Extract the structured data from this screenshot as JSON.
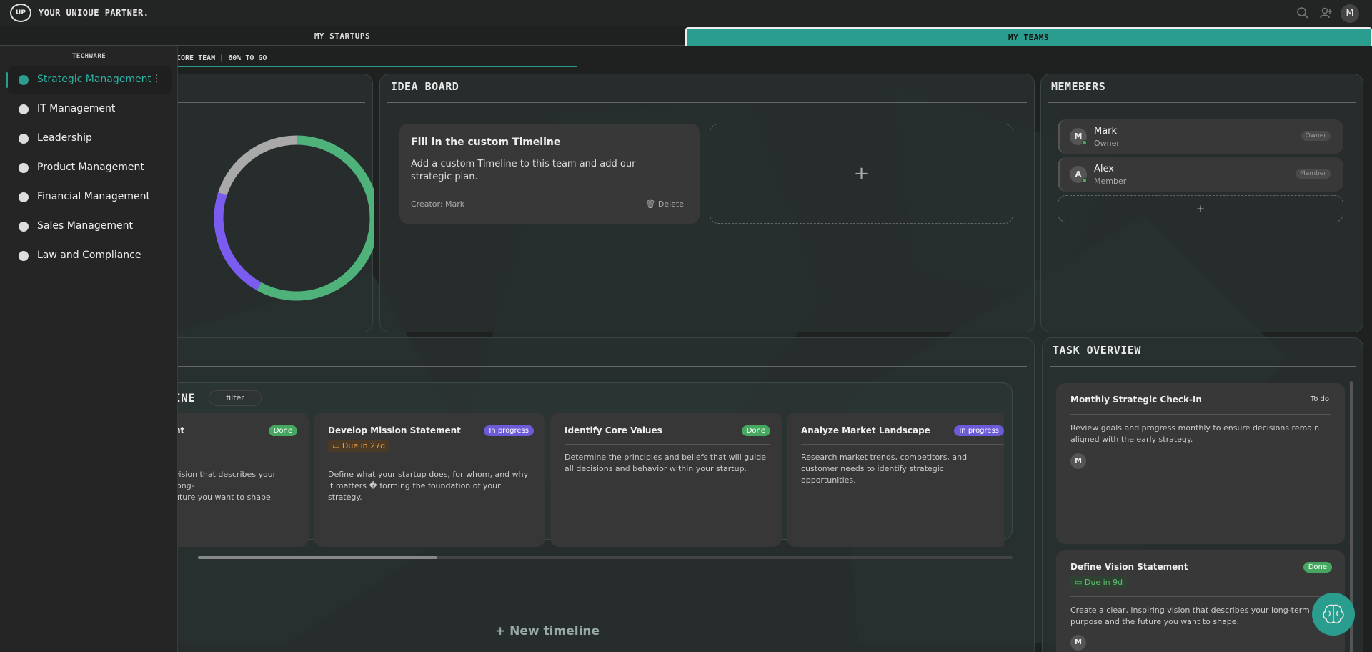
{
  "header": {
    "logo_text": "UP",
    "brand": "YOUR UNIQUE PARTNER.",
    "search_icon": "search-icon",
    "add_user_icon": "add-user-icon",
    "avatar_initial": "M"
  },
  "tabs": [
    {
      "label": "MY STARTUPS",
      "active": false
    },
    {
      "label": "MY TEAMS",
      "active": true
    }
  ],
  "team_progress": {
    "label": "CORE TEAM | 60% TO GO",
    "fraction_done": 0.4
  },
  "sidebar": {
    "heading": "TECHWARE",
    "items": [
      {
        "label": "Strategic Management",
        "active": true
      },
      {
        "label": "IT Management"
      },
      {
        "label": "Leadership"
      },
      {
        "label": "Product Management"
      },
      {
        "label": "Financial Management"
      },
      {
        "label": "Sales Management"
      },
      {
        "label": "Law and Compliance"
      }
    ]
  },
  "donut": {
    "segments": [
      {
        "color": "#4fb27a",
        "value": 0.58
      },
      {
        "color": "#7b5cf0",
        "value": 0.22
      },
      {
        "color": "#a9a9a9",
        "value": 0.2
      }
    ]
  },
  "idea_board": {
    "title": "IDEA BOARD",
    "card": {
      "title": "Fill in the custom Timeline",
      "body": "Add a custom Timeline to this team and add our strategic plan.",
      "creator": "Creator: Mark",
      "delete_label": "Delete"
    },
    "add_symbol": "+"
  },
  "members": {
    "title": "MEMEBERS",
    "list": [
      {
        "initial": "M",
        "name": "Mark",
        "role": "Owner",
        "badge": "Owner"
      },
      {
        "initial": "A",
        "name": "Alex",
        "role": "Member",
        "badge": "Member"
      }
    ],
    "add_symbol": "+"
  },
  "timeline": {
    "title_fragment": "INE",
    "filter_label": "filter",
    "cards": [
      {
        "title": "nt",
        "status": "Done",
        "body": "vision that describes your long-\nuture you want to shape."
      },
      {
        "title": "Develop Mission Statement",
        "status": "In progress",
        "due": "Due in 27d",
        "body": "Define what your startup does, for whom, and why it matters � forming the foundation of your strategy."
      },
      {
        "title": "Identify Core Values",
        "status": "Done",
        "body": "Determine the principles and beliefs that will guide all decisions and behavior within your startup."
      },
      {
        "title": "Analyze Market Landscape",
        "status": "In progress",
        "body": "Research market trends, competitors, and customer needs to identify strategic opportunities."
      }
    ],
    "new_timeline": "+ New timeline"
  },
  "task_overview": {
    "title": "TASK OVERVIEW",
    "tasks": [
      {
        "title": "Monthly Strategic Check-In",
        "status": "To do",
        "body": "Review goals and progress monthly to ensure decisions remain aligned with the early strategy.",
        "assignee": "M"
      },
      {
        "title": "Define Vision Statement",
        "status": "Done",
        "due": "Due in 9d",
        "body": "Create a clear, inspiring vision that describes your long-term purpose and the future you want to shape.",
        "assignee": "M"
      }
    ]
  },
  "assistant_icon": "brain-icon"
}
